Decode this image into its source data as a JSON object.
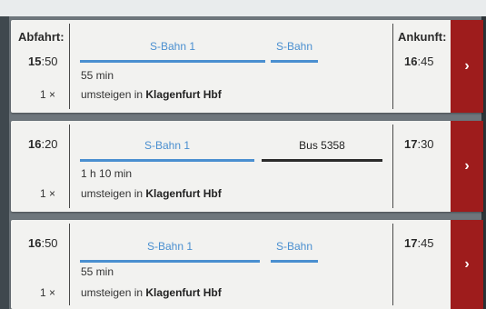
{
  "header": {
    "departure_label": "Abfahrt:",
    "arrival_label": "Ankunft:"
  },
  "connections": [
    {
      "dep_hour": "15",
      "dep_min": ":50",
      "arr_hour": "16",
      "arr_min": ":45",
      "legs": [
        "S-Bahn 1",
        "S-Bahn"
      ],
      "duration": "55 min",
      "transfers": "1 ×",
      "via_prefix": "umsteigen in",
      "via_station": "Klagenfurt Hbf",
      "go_glyph": "›"
    },
    {
      "dep_hour": "16",
      "dep_min": ":20",
      "arr_hour": "17",
      "arr_min": ":30",
      "legs": [
        "S-Bahn 1",
        "Bus 5358"
      ],
      "duration": "1 h 10 min",
      "transfers": "1 ×",
      "via_prefix": "umsteigen in",
      "via_station": "Klagenfurt Hbf",
      "go_glyph": "›"
    },
    {
      "dep_hour": "16",
      "dep_min": ":50",
      "arr_hour": "17",
      "arr_min": ":45",
      "legs": [
        "S-Bahn 1",
        "S-Bahn"
      ],
      "duration": "55 min",
      "transfers": "1 ×",
      "via_prefix": "umsteigen in",
      "via_station": "Klagenfurt Hbf",
      "go_glyph": "›"
    }
  ],
  "colors": {
    "sbahn": "#4a8fd0",
    "bus": "#2b2b2b",
    "action": "#9e1c1c"
  },
  "icons": {
    "go": "chevron-right-icon"
  }
}
